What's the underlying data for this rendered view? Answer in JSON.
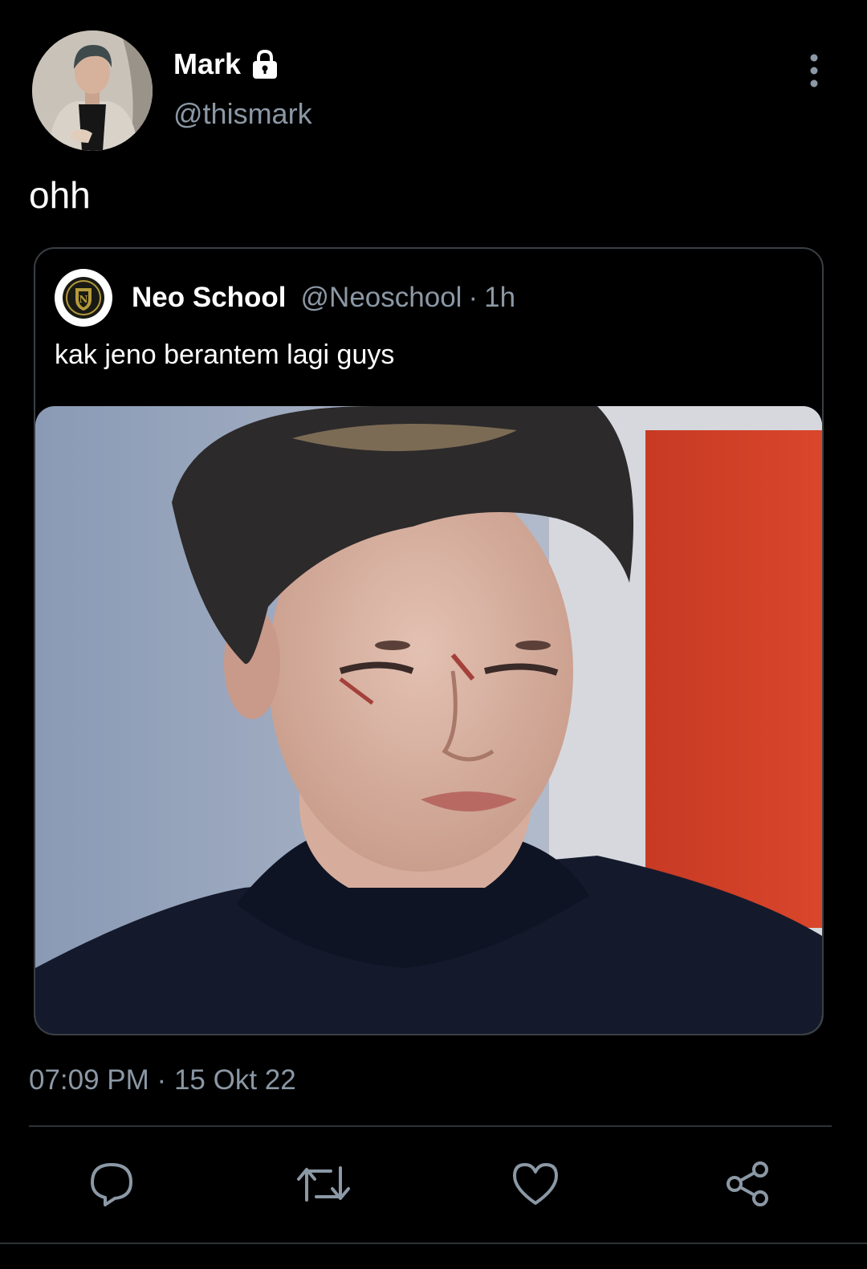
{
  "tweet": {
    "author": {
      "display_name": "Mark",
      "handle": "@thismark",
      "protected_icon": "lock-icon"
    },
    "text": "ohh",
    "timestamp": "07:09 PM",
    "separator": "·",
    "date": "15 Okt 22"
  },
  "quoted_tweet": {
    "display_name": "Neo School",
    "handle": "@Neoschool",
    "separator": "·",
    "time_ago": "1h",
    "text": "kak jeno berantem lagi guys"
  },
  "actions": [
    {
      "name": "reply",
      "icon": "reply-icon"
    },
    {
      "name": "retweet",
      "icon": "retweet-icon"
    },
    {
      "name": "like",
      "icon": "heart-icon"
    },
    {
      "name": "share",
      "icon": "share-icon"
    }
  ],
  "colors": {
    "background": "#000000",
    "primary_text": "#ffffff",
    "secondary_text": "#8b98a5",
    "border": "#3a3f44",
    "icon": "#8b98a5"
  }
}
